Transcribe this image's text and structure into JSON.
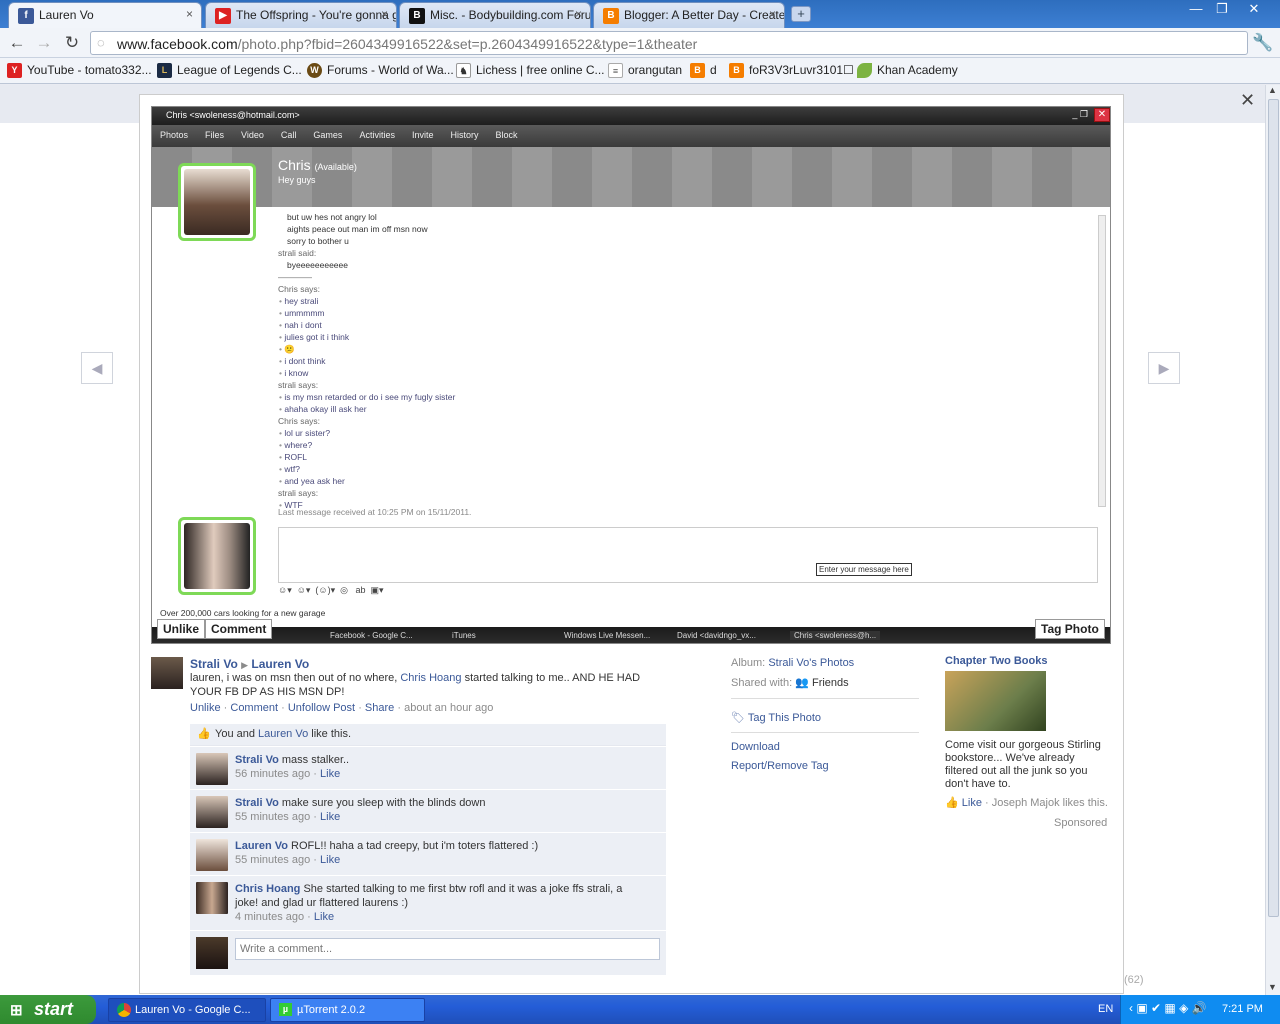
{
  "browser": {
    "tabs": [
      {
        "title": "Lauren Vo",
        "icon": "facebook-icon",
        "active": true
      },
      {
        "title": "The Offspring - You're gonna g",
        "icon": "youtube-icon"
      },
      {
        "title": "Misc. - Bodybuilding.com Forur",
        "icon": "bodybuilding-icon"
      },
      {
        "title": "Blogger: A Better Day - Create",
        "icon": "blogger-icon"
      }
    ],
    "url_host": "www.facebook.com",
    "url_path": "/photo.php?fbid=2604349916522&set=p.2604349916522&type=1&theater",
    "bookmarks": [
      {
        "label": "YouTube - tomato332...",
        "icon": "youtube-icon"
      },
      {
        "label": "League of Legends C...",
        "icon": "league-icon"
      },
      {
        "label": "Forums - World of Wa...",
        "icon": "wow-icon"
      },
      {
        "label": "Lichess | free online C...",
        "icon": "lichess-icon"
      },
      {
        "label": "orangutan",
        "icon": "page-icon"
      },
      {
        "label": "d",
        "icon": "blogger-icon"
      },
      {
        "label": "foR3V3rLuvr3101☐",
        "icon": "blogger-icon"
      },
      {
        "label": "Khan Academy",
        "icon": "khan-icon"
      }
    ]
  },
  "msn": {
    "window_title": "Chris <swoleness@hotmail.com>",
    "menu": [
      "Photos",
      "Files",
      "Video",
      "Call",
      "Games",
      "Activities",
      "Invite",
      "History",
      "Block"
    ],
    "contact_name": "Chris",
    "contact_status": "(Available)",
    "contact_mood": "Hey guys",
    "conversation": [
      {
        "t": "msg",
        "text": "but uw hes not angry lol"
      },
      {
        "t": "msg",
        "text": "aights peace out man im off msn now"
      },
      {
        "t": "msg",
        "text": "sorry to bother u"
      },
      {
        "t": "who",
        "text": "strali said:"
      },
      {
        "t": "msg",
        "text": "byeeeeeeeeeee"
      },
      {
        "t": "sep",
        "text": "————"
      },
      {
        "t": "who",
        "text": "Chris says:"
      },
      {
        "t": "bmsg",
        "text": "hey strali"
      },
      {
        "t": "bmsg",
        "text": "ummmmm"
      },
      {
        "t": "bmsg",
        "text": "nah i dont"
      },
      {
        "t": "bmsg",
        "text": "julies got it i think"
      },
      {
        "t": "bmsg",
        "text": "😕"
      },
      {
        "t": "bmsg",
        "text": "i dont think"
      },
      {
        "t": "bmsg",
        "text": "i know"
      },
      {
        "t": "who",
        "text": "strali says:"
      },
      {
        "t": "bmsg",
        "text": "is my msn retarded or do i see my fugly sister"
      },
      {
        "t": "bmsg",
        "text": "ahaha okay ill ask her"
      },
      {
        "t": "who",
        "text": "Chris says:"
      },
      {
        "t": "bmsg",
        "text": "lol ur sister?"
      },
      {
        "t": "bmsg",
        "text": "where?"
      },
      {
        "t": "bmsg",
        "text": "ROFL"
      },
      {
        "t": "bmsg",
        "text": "wtf?"
      },
      {
        "t": "bmsg",
        "text": "and yea ask her"
      },
      {
        "t": "who",
        "text": "strali says:"
      },
      {
        "t": "bmsg",
        "text": "WTF"
      }
    ],
    "last_message": "Last message received at 10:25 PM on 15/11/2011.",
    "input_hint": "Enter your message here",
    "ad_line": "Over 200,000 cars looking for a new garage",
    "mini_taskbar": [
      "Facebook - Google C...",
      "iTunes",
      "Windows Live Messen...",
      "David <davidngo_vx...",
      "Chris <swoleness@h..."
    ]
  },
  "photo_actions": {
    "unlike": "Unlike",
    "comment": "Comment",
    "tag_photo": "Tag Photo"
  },
  "story": {
    "author": "Strali Vo",
    "arrow": "▶",
    "target": "Lauren Vo",
    "text_before": "lauren, i was on msn then out of no where,",
    "mention": "Chris Hoang",
    "text_after": "started talking to me.. AND HE HAD YOUR FB DP AS HIS MSN DP!",
    "actions": [
      "Unlike",
      "Comment",
      "Unfollow Post",
      "Share"
    ],
    "time": "about an hour ago",
    "likes_prefix": "You and",
    "likes_name": "Lauren Vo",
    "likes_suffix": "like this."
  },
  "comments": [
    {
      "name": "Strali Vo",
      "text": "mass stalker..",
      "time": "56 minutes ago",
      "like": "Like"
    },
    {
      "name": "Strali Vo",
      "text": "make sure you sleep with the blinds down",
      "time": "55 minutes ago",
      "like": "Like"
    },
    {
      "name": "Lauren Vo",
      "text": "ROFL!! haha a tad creepy, but i'm toters flattered :)",
      "time": "55 minutes ago",
      "like": "Like"
    },
    {
      "name": "Chris Hoang",
      "text": "She started talking to me first btw rofl and it was a joke ffs strali, a joke! and glad ur flattered laurens :)",
      "time": "4 minutes ago",
      "like": "Like"
    }
  ],
  "write_comment_placeholder": "Write a comment...",
  "info": {
    "album_label": "Album:",
    "album_value": "Strali Vo's Photos",
    "shared_label": "Shared with:",
    "shared_value": "Friends",
    "tag_this_photo": "Tag This Photo",
    "download": "Download",
    "report": "Report/Remove Tag"
  },
  "ad": {
    "title": "Chapter Two Books",
    "body": "Come visit our gorgeous Stirling bookstore... We've already filtered out all the junk so you don't have to.",
    "like": "Like",
    "like_suffix": "· Joseph Majok likes this.",
    "sponsored": "Sponsored"
  },
  "page_count": "(62)",
  "taskbar": {
    "start": "start",
    "items": [
      {
        "label": "Lauren Vo - Google C...",
        "icon": "chrome-icon"
      },
      {
        "label": "µTorrent 2.0.2",
        "icon": "utorrent-icon"
      }
    ],
    "lang": "EN",
    "clock": "7:21 PM"
  }
}
